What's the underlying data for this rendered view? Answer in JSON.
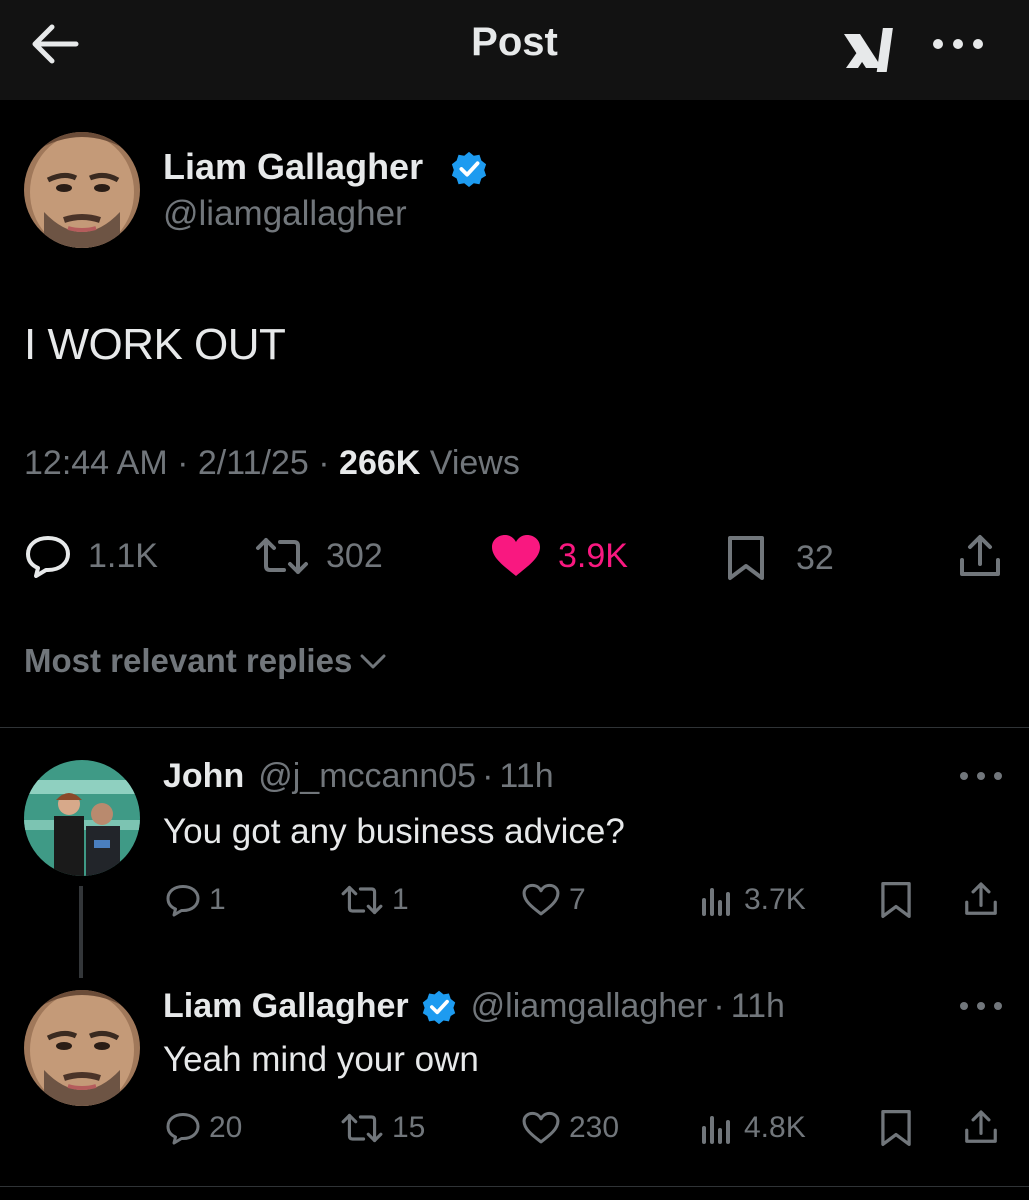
{
  "header": {
    "title": "Post",
    "back_icon": "arrow-left-icon",
    "grok_icon": "grok-icon",
    "more_icon": "more-horizontal-icon"
  },
  "post": {
    "author_name": "Liam Gallagher",
    "author_handle": "@liamgallagher",
    "verified": true,
    "text": "I WORK OUT",
    "time": "12:44 AM",
    "date": "2/11/25",
    "views_count": "266K",
    "views_label": "Views",
    "stats": {
      "replies": "1.1K",
      "reposts": "302",
      "likes": "3.9K",
      "bookmarks": "32"
    },
    "liked": true
  },
  "replies_sort": {
    "label": "Most relevant replies"
  },
  "replies": [
    {
      "name": "John",
      "handle": "@j_mccann05",
      "time": "11h",
      "text": "You got any business advice?",
      "verified": false,
      "stats": {
        "replies": "1",
        "reposts": "1",
        "likes": "7",
        "views": "3.7K"
      }
    },
    {
      "name": "Liam Gallagher",
      "handle": "@liamgallagher",
      "time": "11h",
      "text": "Yeah mind your own",
      "verified": true,
      "stats": {
        "replies": "20",
        "reposts": "15",
        "likes": "230",
        "views": "4.8K"
      }
    }
  ],
  "colors": {
    "background": "#000000",
    "header_bg": "#121212",
    "text_primary": "#e7e9ea",
    "text_secondary": "#71767b",
    "like_pink": "#f91880",
    "verified_blue": "#1d9bf0"
  },
  "separator": "·"
}
